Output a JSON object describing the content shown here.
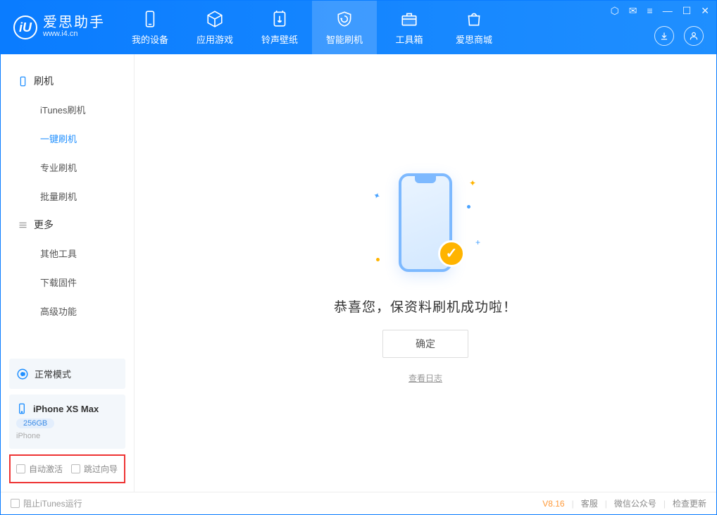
{
  "app": {
    "name": "爱思助手",
    "url": "www.i4.cn"
  },
  "tabs": {
    "device": "我的设备",
    "apps": "应用游戏",
    "ringtone": "铃声壁纸",
    "flash": "智能刷机",
    "toolbox": "工具箱",
    "store": "爱思商城"
  },
  "sidebar": {
    "flash_header": "刷机",
    "items": {
      "itunes": "iTunes刷机",
      "oneclick": "一键刷机",
      "pro": "专业刷机",
      "batch": "批量刷机"
    },
    "more_header": "更多",
    "more": {
      "other": "其他工具",
      "firmware": "下载固件",
      "advanced": "高级功能"
    }
  },
  "mode": {
    "label": "正常模式"
  },
  "device": {
    "name": "iPhone XS Max",
    "capacity": "256GB",
    "type": "iPhone"
  },
  "options": {
    "auto_activate": "自动激活",
    "skip_guide": "跳过向导"
  },
  "main": {
    "success": "恭喜您，保资料刷机成功啦！",
    "ok": "确定",
    "view_log": "查看日志"
  },
  "footer": {
    "block_itunes": "阻止iTunes运行",
    "version": "V8.16",
    "support": "客服",
    "wechat": "微信公众号",
    "update": "检查更新"
  }
}
